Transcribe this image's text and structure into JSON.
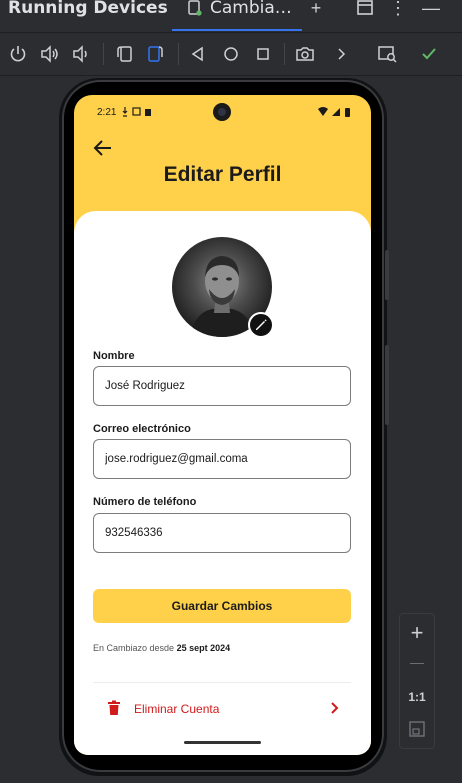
{
  "ide": {
    "tool_window_title": "Running Devices",
    "tab_label": "Cambia…",
    "add_tab": "+",
    "more": "⋮",
    "minimize": "—"
  },
  "zoom_panel": {
    "zoom_in": "+",
    "zoom_out": "—",
    "actual_size": "1:1"
  },
  "status_bar": {
    "time": "2:21"
  },
  "screen": {
    "title": "Editar Perfil",
    "fields": [
      {
        "label": "Nombre",
        "value": "José Rodriguez"
      },
      {
        "label": "Correo electrónico",
        "value": "jose.rodriguez@gmail.coma"
      },
      {
        "label": "Número de  teléfono",
        "value": "932546336"
      }
    ],
    "save_label": "Guardar Cambios",
    "since_prefix": "En Cambiazo desde",
    "since_date": "25 sept 2024",
    "delete_label": "Eliminar Cuenta"
  },
  "colors": {
    "accent": "#ffd14a",
    "danger": "#d11a1a",
    "ide_bg": "#2b2d30",
    "ide_accent": "#3574f0"
  }
}
